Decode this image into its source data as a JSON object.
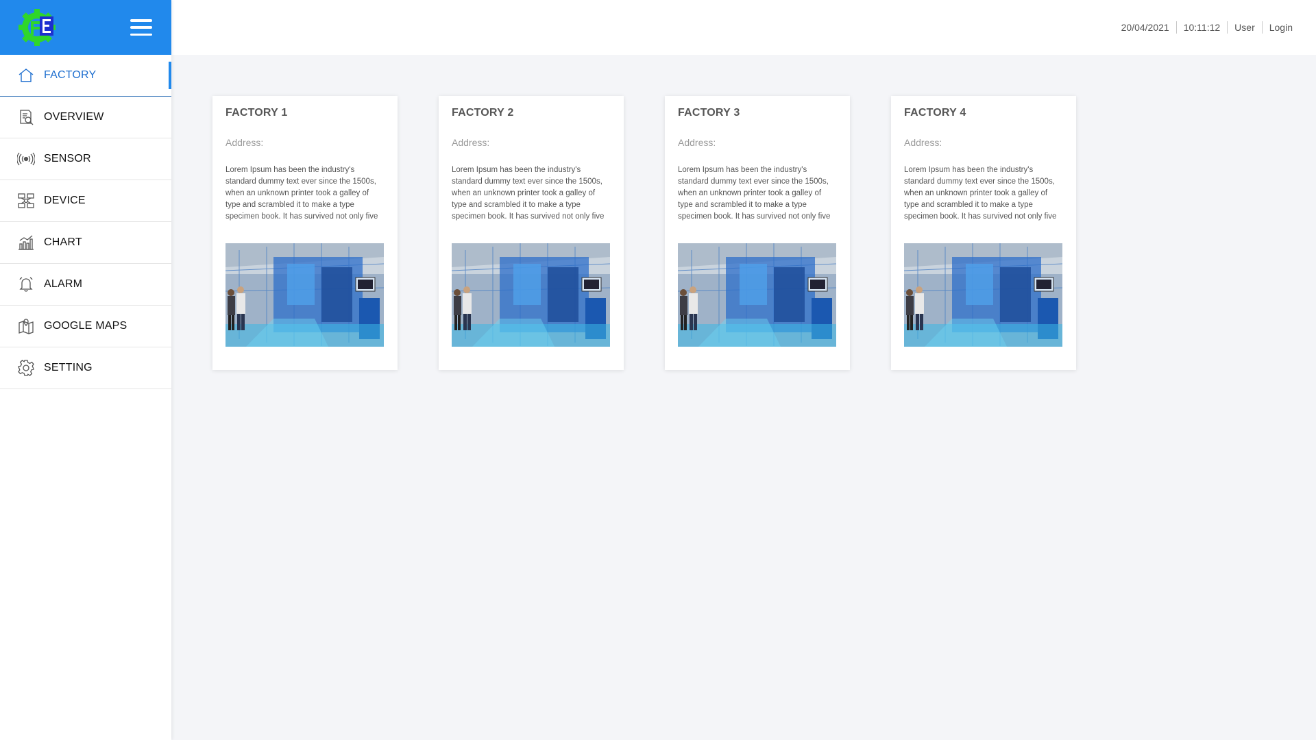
{
  "header": {
    "date": "20/04/2021",
    "time": "10:11:12",
    "user": "User",
    "login": "Login"
  },
  "sidebar": {
    "logo_icon": "gear-logo-icon",
    "menu_icon": "hamburger-menu-icon",
    "items": [
      {
        "label": "FACTORY",
        "icon": "home-icon",
        "active": true
      },
      {
        "label": "OVERVIEW",
        "icon": "report-search-icon",
        "active": false
      },
      {
        "label": "SENSOR",
        "icon": "broadcast-icon",
        "active": false
      },
      {
        "label": "DEVICE",
        "icon": "device-network-icon",
        "active": false
      },
      {
        "label": "CHART",
        "icon": "chart-icon",
        "active": false
      },
      {
        "label": "ALARM",
        "icon": "bell-icon",
        "active": false
      },
      {
        "label": "GOOGLE MAPS",
        "icon": "map-icon",
        "active": false
      },
      {
        "label": "SETTING",
        "icon": "gear-icon",
        "active": false
      }
    ]
  },
  "cards": [
    {
      "title": "FACTORY 1",
      "address": "Address:",
      "description": "Lorem Ipsum has been the industry's standard dummy text ever since the 1500s, when an unknown printer took a galley of type and scrambled it to make a type specimen book. It has survived not only five centuries, but also the leap into"
    },
    {
      "title": "FACTORY 2",
      "address": "Address:",
      "description": "Lorem Ipsum has been the industry's standard dummy text ever since the 1500s, when an unknown printer took a galley of type and scrambled it to make a type specimen book. It has survived not only five centuries, but also the leap into"
    },
    {
      "title": "FACTORY 3",
      "address": "Address:",
      "description": "Lorem Ipsum has been the industry's standard dummy text ever since the 1500s, when an unknown printer took a galley of type and scrambled it to make a type specimen book. It has survived not only five centuries, but also the leap into"
    },
    {
      "title": "FACTORY 4",
      "address": "Address:",
      "description": "Lorem Ipsum has been the industry's standard dummy text ever since the 1500s, when an unknown printer took a galley of type and scrambled it to make a type specimen book. It has survived not only five centuries, but also the leap into"
    }
  ],
  "colors": {
    "brand_blue": "#2189ec",
    "active_text": "#1f6fcf",
    "logo_green": "#2fd62a",
    "logo_blue": "#1d2fd0",
    "background": "#f4f5f8"
  }
}
